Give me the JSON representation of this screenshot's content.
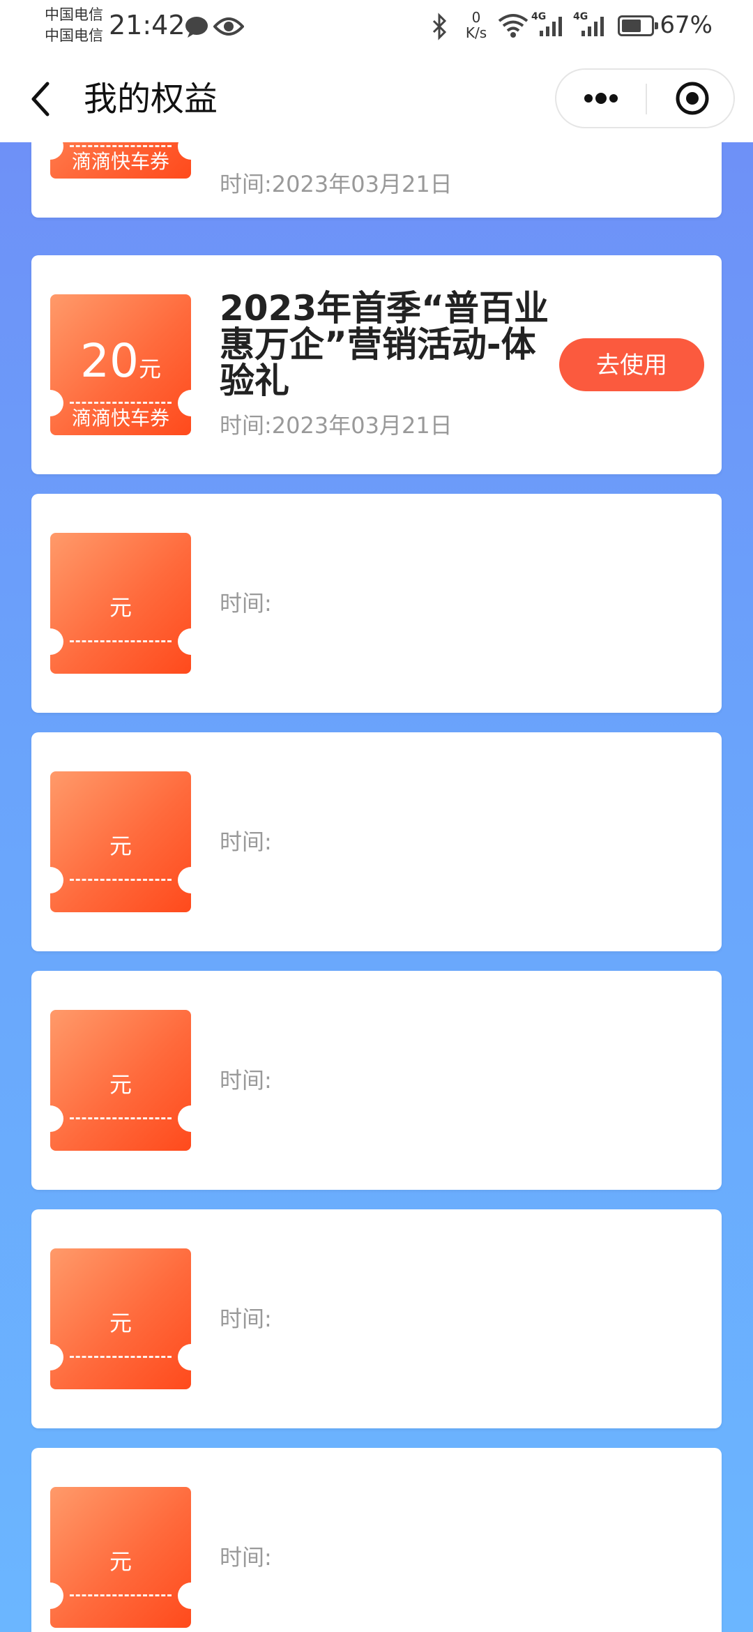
{
  "status_bar": {
    "carrier_1": "中国电信",
    "carrier_2": "中国电信",
    "time": "21:42",
    "net_speed_value": "0",
    "net_speed_unit": "K/s",
    "signal_1_label": "4G",
    "signal_2_label": "4G",
    "battery_percent": "67%",
    "battery_level": 0.67
  },
  "nav": {
    "title": "我的权益"
  },
  "cards": [
    {
      "amount": "",
      "unit": "",
      "coupon_type": "滴滴快车券",
      "title": "",
      "time_label": "时间:",
      "time_value": "2023年03月21日",
      "button": ""
    },
    {
      "amount": "20",
      "unit": "元",
      "coupon_type": "滴滴快车券",
      "title": "2023年首季“普百业惠万企”营销活动-体验礼",
      "time_label": "时间:",
      "time_value": "2023年03月21日",
      "button": "去使用"
    },
    {
      "amount": "",
      "unit": "元",
      "coupon_type": "",
      "title": "",
      "time_label": "时间:",
      "time_value": "",
      "button": ""
    },
    {
      "amount": "",
      "unit": "元",
      "coupon_type": "",
      "title": "",
      "time_label": "时间:",
      "time_value": "",
      "button": ""
    },
    {
      "amount": "",
      "unit": "元",
      "coupon_type": "",
      "title": "",
      "time_label": "时间:",
      "time_value": "",
      "button": ""
    },
    {
      "amount": "",
      "unit": "元",
      "coupon_type": "",
      "title": "",
      "time_label": "时间:",
      "time_value": "",
      "button": ""
    },
    {
      "amount": "",
      "unit": "元",
      "coupon_type": "",
      "title": "",
      "time_label": "时间:",
      "time_value": "",
      "button": ""
    }
  ],
  "icons": {
    "back": "chevron-left-icon",
    "more": "more-dots-icon",
    "close": "target-circle-icon",
    "chat": "chat-bubble-icon",
    "eye": "eye-icon",
    "bluetooth": "bluetooth-icon",
    "wifi": "wifi-icon",
    "signal": "signal-bars-icon",
    "battery": "battery-icon"
  },
  "colors": {
    "accent": "#fb5a3e",
    "coupon_start": "#ff9a6a",
    "coupon_end": "#ff4a1c",
    "background_top": "#6f8cf6",
    "background_bottom": "#6bb6ff"
  }
}
